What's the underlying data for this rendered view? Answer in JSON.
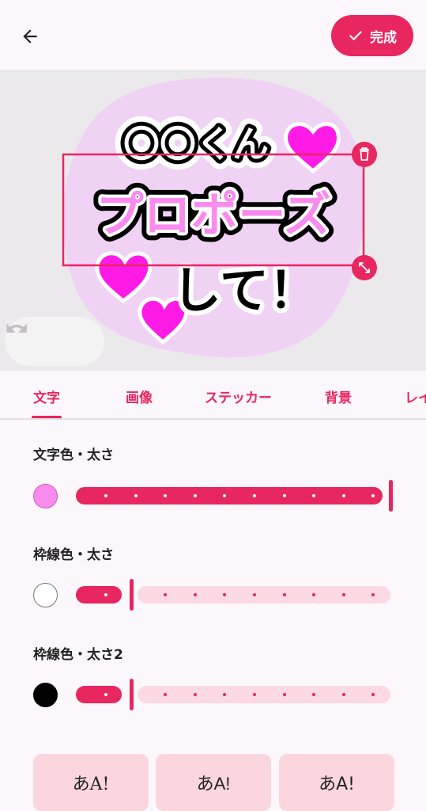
{
  "header": {
    "done_label": "完成"
  },
  "canvas": {
    "sticker_lines": [
      "〇〇くん",
      "プロポーズ",
      "して！"
    ],
    "colors": {
      "bg_blob": "#f0d2f5",
      "heart": "#ff1ae6",
      "pink_text": "#f98bef",
      "selection": "#e8265f"
    }
  },
  "tabs": [
    "文字",
    "画像",
    "ステッカー",
    "背景",
    "レイ"
  ],
  "sections": {
    "text_color": {
      "label": "文字色・太さ",
      "color": "#f98bef",
      "value": 1.0
    },
    "outline_color": {
      "label": "枠線色・太さ",
      "color": "#ffffff",
      "value": 0.2
    },
    "outline_color2": {
      "label": "枠線色・太さ2",
      "color": "#000000",
      "value": 0.2
    }
  },
  "font_styles": [
    "あA!",
    "あA!",
    "あA!"
  ],
  "accent": "#e8265f"
}
